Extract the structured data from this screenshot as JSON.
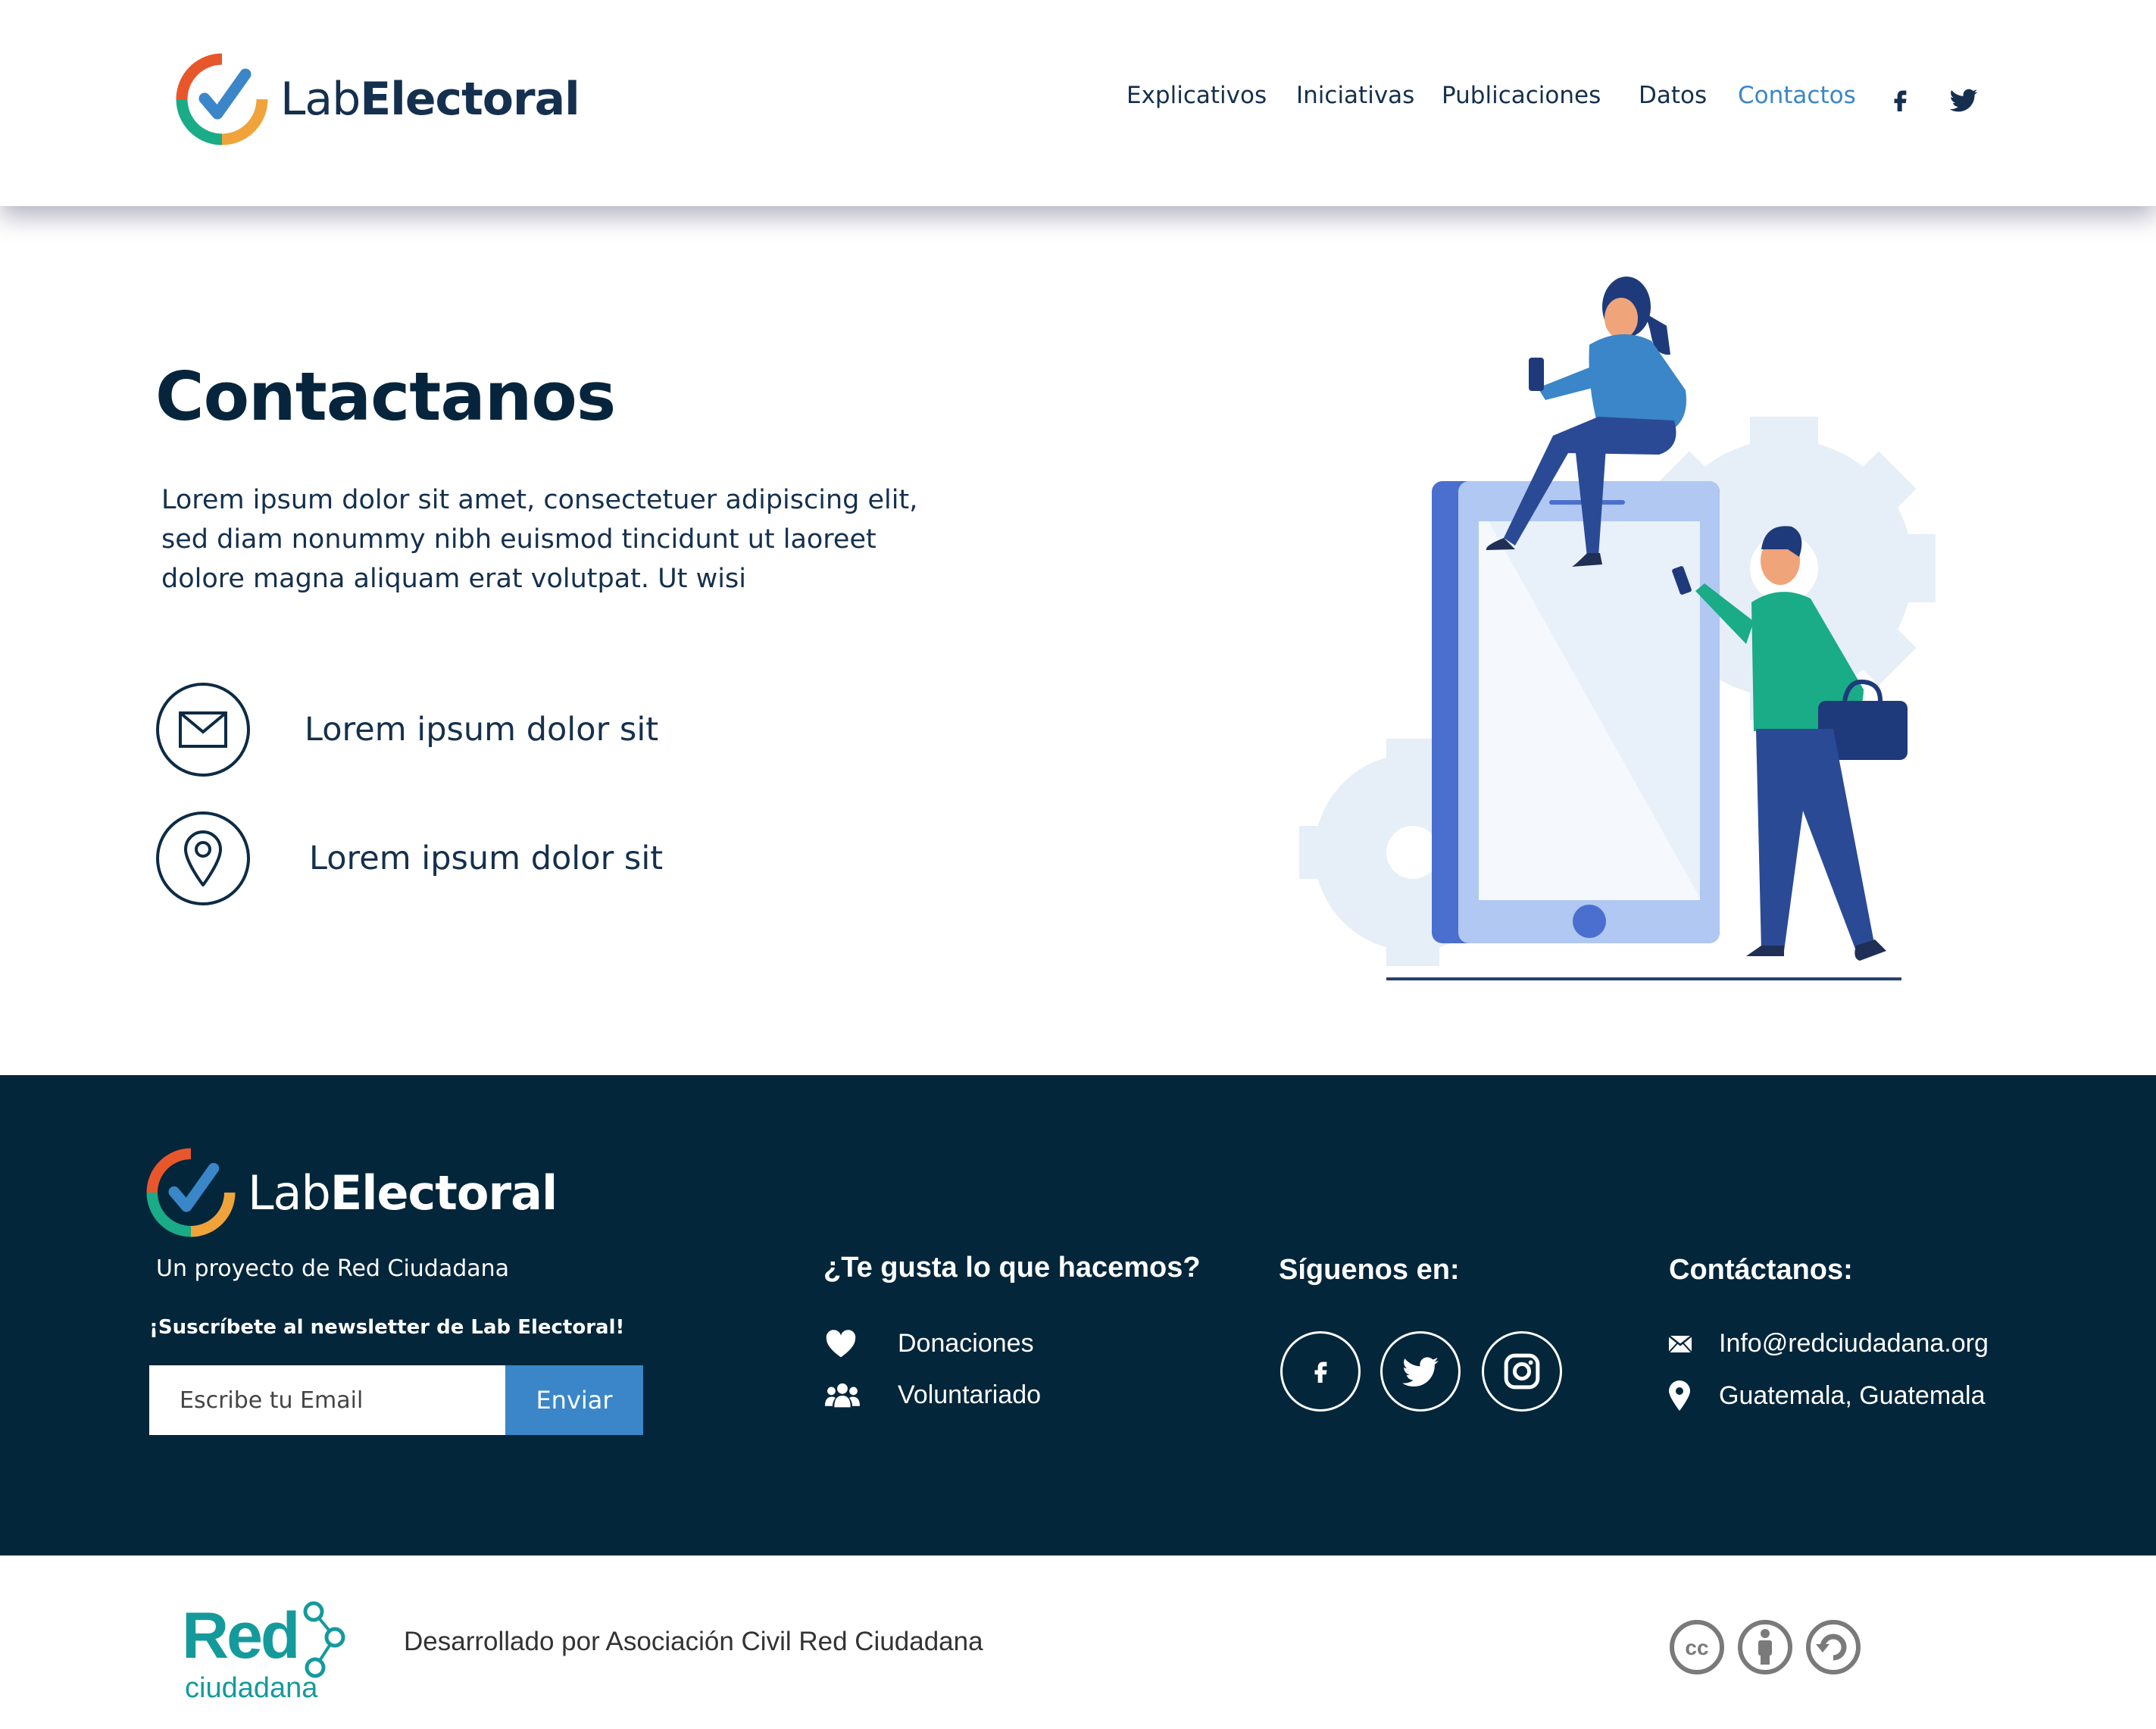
{
  "header": {
    "logo": {
      "light": "Lab",
      "bold": "Electoral"
    },
    "nav": [
      "Explicativos",
      "Iniciativas",
      "Publicaciones",
      "Datos",
      "Contactos"
    ],
    "active_item": "Contactos",
    "social_icons": [
      "facebook-icon",
      "twitter-icon"
    ]
  },
  "main": {
    "title": "Contactanos",
    "description": [
      "Lorem ipsum dolor sit amet, consectetuer adipiscing elit,",
      "sed diam nonummy nibh euismod tincidunt ut laoreet",
      "dolore magna aliquam erat volutpat. Ut wisi"
    ],
    "contact_items": [
      {
        "icon": "envelope-icon",
        "text": "Lorem ipsum dolor sit"
      },
      {
        "icon": "map-pin-icon",
        "text": "Lorem ipsum dolor sit"
      }
    ]
  },
  "footer": {
    "logo": {
      "light": "Lab",
      "bold": "Electoral"
    },
    "tagline": "Un proyecto de Red Ciudadana",
    "newsletter_label": "¡Suscríbete al newsletter de Lab Electoral!",
    "email_placeholder": "Escribe tu Email",
    "submit_label": "Enviar",
    "support": {
      "heading": "¿Te gusta lo que hacemos?",
      "links": [
        {
          "icon": "heart-icon",
          "label": "Donaciones"
        },
        {
          "icon": "people-icon",
          "label": "Voluntariado"
        }
      ]
    },
    "follow": {
      "heading": "Síguenos en:",
      "icons": [
        "facebook-icon",
        "twitter-icon",
        "instagram-icon"
      ]
    },
    "contact": {
      "heading": "Contáctanos:",
      "email": "Info@redciudadana.org",
      "location": "Guatemala, Guatemala"
    }
  },
  "bottom": {
    "org_logo": {
      "top": "Red",
      "bottom": "ciudadana"
    },
    "developed_by": "Desarrollado por Asociación Civil Red Ciudadana",
    "license_icons": [
      "cc-icon",
      "by-icon",
      "sa-icon"
    ]
  },
  "colors": {
    "navy": "#03263b",
    "accent": "#3a86c8",
    "green": "#1aab87",
    "teal": "#159a9c"
  }
}
